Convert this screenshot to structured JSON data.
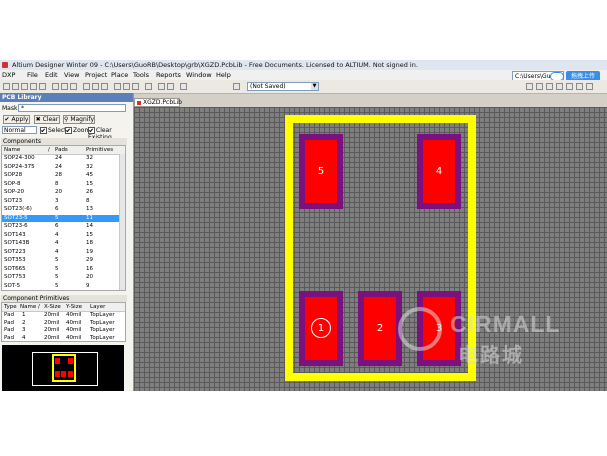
{
  "window": {
    "title": "Altium Designer Winter 09 - C:\\Users\\GuoRB\\Desktop\\grb\\XGZD.PcbLib - Free Documents. Licensed to ALTIUM. Not signed in.",
    "path_box": "C:\\Users\\Guo",
    "upload_label": "拖拽上传"
  },
  "menu": [
    "DXP",
    "File",
    "Edit",
    "View",
    "Project",
    "Place",
    "Tools",
    "Reports",
    "Window",
    "Help"
  ],
  "toolbar": {
    "saved_combo": "(Not Saved)"
  },
  "pcb_library": {
    "title": "PCB Library",
    "mask_label": "Mask",
    "mask_value": "*",
    "apply_label": "Apply",
    "clear_label": "Clear",
    "magnify_label": "Magnify",
    "mode_value": "Normal",
    "select_label": "Select",
    "zoom_label": "Zoom",
    "clear_existing_label": "Clear Existing",
    "components_title": "Components",
    "components_headers": [
      "Name",
      "/",
      "Pads",
      "Primitives"
    ],
    "components": [
      {
        "name": "SOP24-300",
        "pads": "24",
        "prims": "32"
      },
      {
        "name": "SOP24-375",
        "pads": "24",
        "prims": "32"
      },
      {
        "name": "SOP28",
        "pads": "28",
        "prims": "45"
      },
      {
        "name": "SOP-8",
        "pads": "8",
        "prims": "15"
      },
      {
        "name": "SOP-20",
        "pads": "20",
        "prims": "26"
      },
      {
        "name": "SOT23",
        "pads": "3",
        "prims": "8"
      },
      {
        "name": "SOT23(-6)",
        "pads": "6",
        "prims": "13"
      },
      {
        "name": "SOT23-5",
        "pads": "5",
        "prims": "11"
      },
      {
        "name": "SOT23-6",
        "pads": "6",
        "prims": "14"
      },
      {
        "name": "SOT143",
        "pads": "4",
        "prims": "15"
      },
      {
        "name": "SOT143B",
        "pads": "4",
        "prims": "18"
      },
      {
        "name": "SOT223",
        "pads": "4",
        "prims": "19"
      },
      {
        "name": "SOT353",
        "pads": "5",
        "prims": "29"
      },
      {
        "name": "SOT665",
        "pads": "5",
        "prims": "16"
      },
      {
        "name": "SOT753",
        "pads": "5",
        "prims": "20"
      },
      {
        "name": "SOT-5",
        "pads": "5",
        "prims": "9"
      }
    ],
    "selected_component": "SOT23-5",
    "primitives_title": "Component Primitives",
    "primitives_headers": [
      "Type",
      "Name",
      "/",
      "X-Size",
      "Y-Size",
      "Layer"
    ],
    "primitives": [
      {
        "type": "Pad",
        "name": "1",
        "x": "20mil",
        "y": "40mil",
        "layer": "TopLayer"
      },
      {
        "type": "Pad",
        "name": "2",
        "x": "20mil",
        "y": "40mil",
        "layer": "TopLayer"
      },
      {
        "type": "Pad",
        "name": "3",
        "x": "20mil",
        "y": "40mil",
        "layer": "TopLayer"
      },
      {
        "type": "Pad",
        "name": "4",
        "x": "20mil",
        "y": "40mil",
        "layer": "TopLayer"
      }
    ]
  },
  "document_tab": "XGZD.PcbLib",
  "footprint": {
    "pads": [
      "5",
      "4",
      "1",
      "2",
      "3"
    ],
    "colors": {
      "outline": "#ffff00",
      "pad_copper": "#ff0000",
      "pad_mask": "#7a117f",
      "canvas_grid": "#7f7f7f"
    }
  },
  "watermark": {
    "line1": "CIRMALL",
    "line2": "电路城"
  }
}
